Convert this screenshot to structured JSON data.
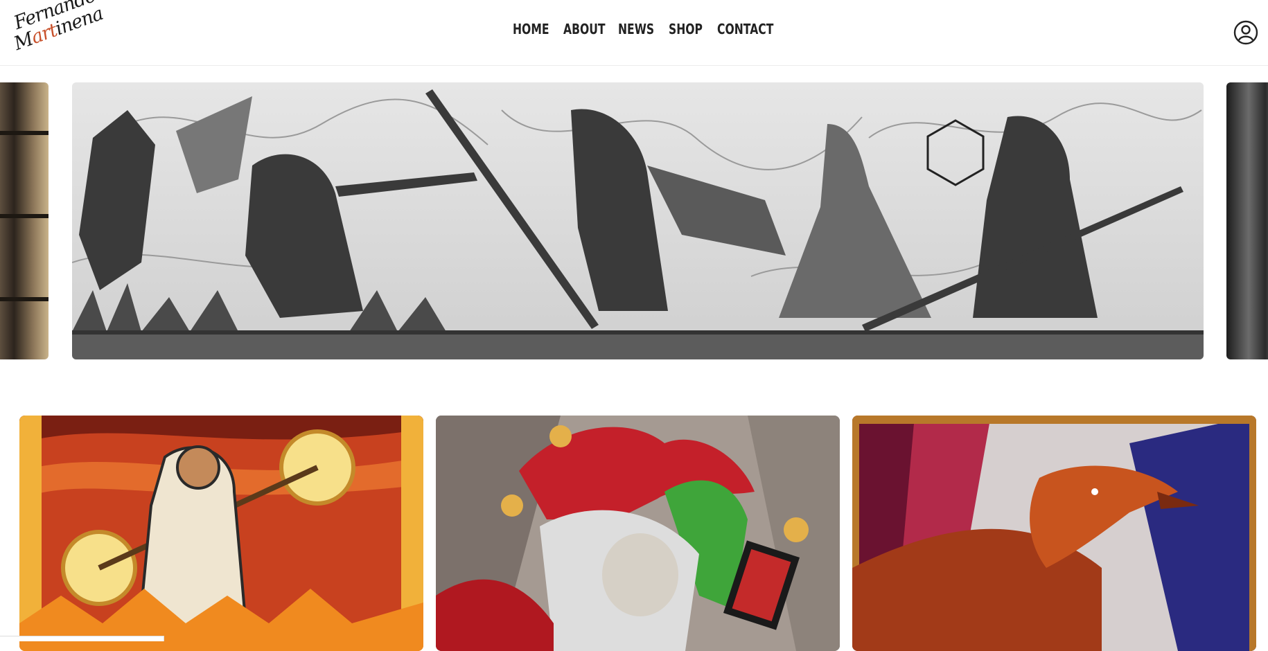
{
  "logo": {
    "line1": "Fernando",
    "line2_part1": "M",
    "line2_accent": "art",
    "line2_part2": "inena"
  },
  "nav": {
    "items": [
      {
        "label": "HOME"
      },
      {
        "label": "ABOUT"
      },
      {
        "label": "NEWS"
      },
      {
        "label": "SHOP"
      },
      {
        "label": "CONTACT"
      }
    ]
  },
  "icons": {
    "user": "user-account-icon"
  },
  "carousel": {
    "current_slide_subject": "black-and-white fantasy battle illustration"
  },
  "gallery": {
    "cards": [
      {
        "subject": "stained glass wizard"
      },
      {
        "subject": "jester with card"
      },
      {
        "subject": "red dragon"
      }
    ]
  },
  "colors": {
    "accent": "#c8502a",
    "text": "#222222"
  }
}
